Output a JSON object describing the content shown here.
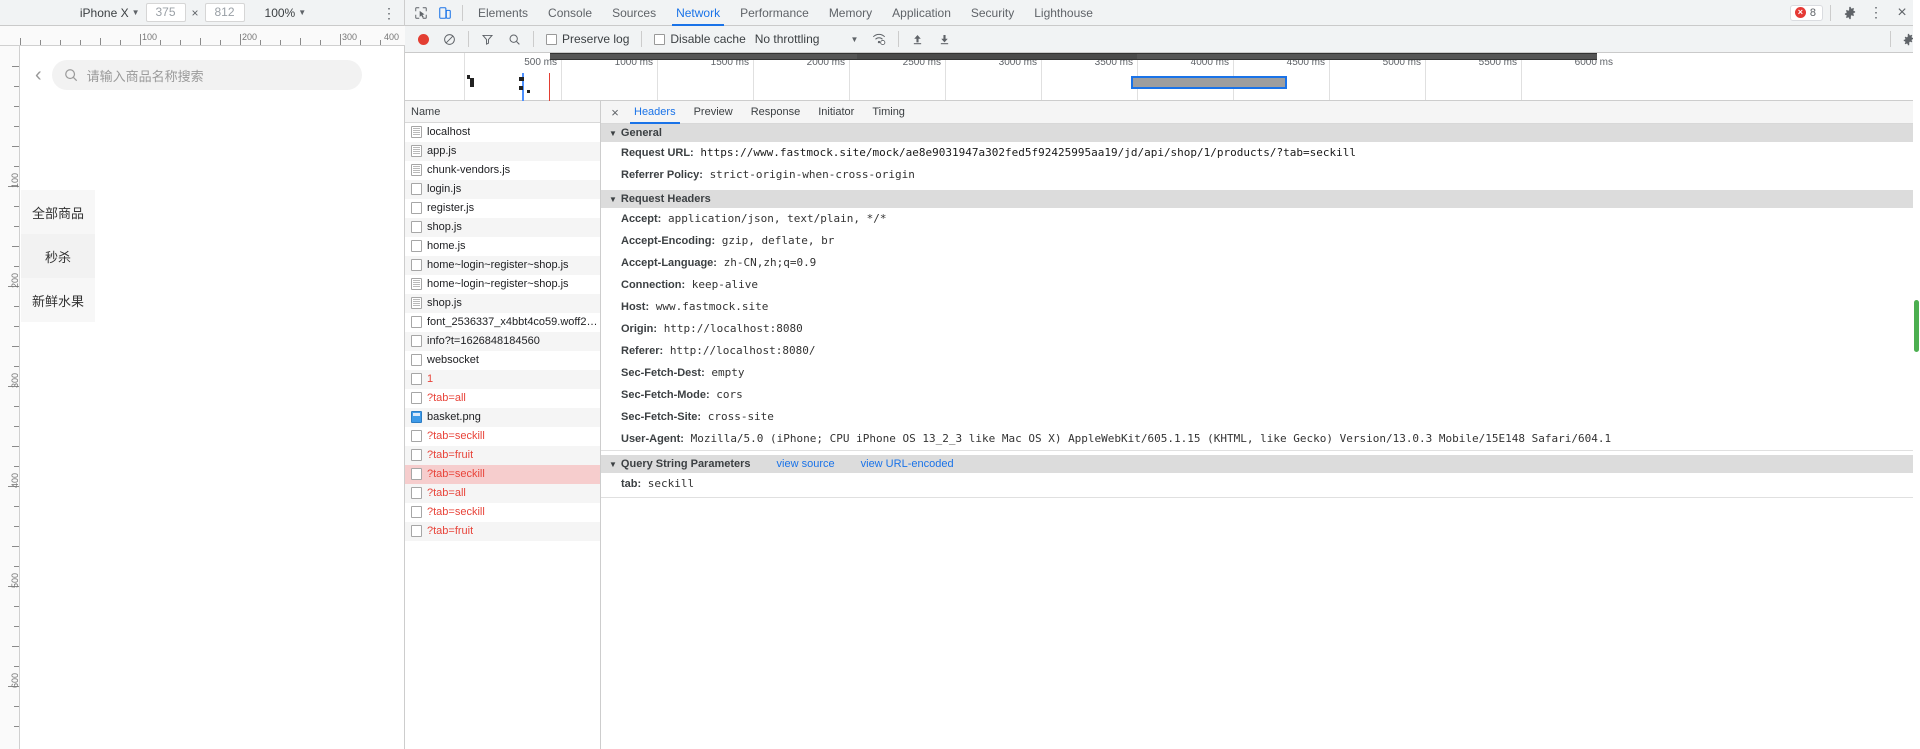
{
  "device_toolbar": {
    "device": "iPhone X",
    "width": "375",
    "height": "812",
    "zoom": "100%",
    "more_label": "⋮"
  },
  "mobile": {
    "back_icon": "‹",
    "search_placeholder": "请输入商品名称搜索",
    "categories": [
      {
        "label": "全部商品",
        "selected": false
      },
      {
        "label": "秒杀",
        "selected": true
      },
      {
        "label": "新鲜水果",
        "selected": false
      }
    ]
  },
  "ruler": {
    "h_labels": [
      "100",
      "200",
      "300",
      "400"
    ],
    "v_labels": [
      "100",
      "200",
      "300",
      "400",
      "500",
      "600"
    ]
  },
  "devtools": {
    "tabs": [
      {
        "label": "Elements",
        "active": false
      },
      {
        "label": "Console",
        "active": false
      },
      {
        "label": "Sources",
        "active": false
      },
      {
        "label": "Network",
        "active": true
      },
      {
        "label": "Performance",
        "active": false
      },
      {
        "label": "Memory",
        "active": false
      },
      {
        "label": "Application",
        "active": false
      },
      {
        "label": "Security",
        "active": false
      },
      {
        "label": "Lighthouse",
        "active": false
      }
    ],
    "error_count": "8",
    "error_glyph": "×",
    "settings_icon": "gear-icon",
    "more_icon": "⋮",
    "close_icon": "×"
  },
  "network_toolbar": {
    "record_label": "record-button",
    "clear_label": "clear-button",
    "filter_label": "filter-button",
    "search_label": "search-button",
    "preserve_log": "Preserve log",
    "disable_cache": "Disable cache",
    "throttling": "No throttling",
    "throttle_caret": "▼",
    "online_icon": "wifi-icon",
    "import_icon": "↑",
    "export_icon": "↓"
  },
  "overview": {
    "ticks": [
      "500 ms",
      "1000 ms",
      "1500 ms",
      "2000 ms",
      "2500 ms",
      "3000 ms",
      "3500 ms",
      "4000 ms",
      "4500 ms",
      "5000 ms",
      "5500 ms",
      "6000 ms"
    ],
    "selection_start_ms": "3350",
    "selection_end_ms": "4150"
  },
  "requests": {
    "column_name": "Name",
    "rows": [
      {
        "name": "localhost",
        "icon": "doc",
        "error": false,
        "selected": false
      },
      {
        "name": "app.js",
        "icon": "doc",
        "error": false,
        "selected": false
      },
      {
        "name": "chunk-vendors.js",
        "icon": "doc",
        "error": false,
        "selected": false
      },
      {
        "name": "login.js",
        "icon": "file",
        "error": false,
        "selected": false
      },
      {
        "name": "register.js",
        "icon": "file",
        "error": false,
        "selected": false
      },
      {
        "name": "shop.js",
        "icon": "file",
        "error": false,
        "selected": false
      },
      {
        "name": "home.js",
        "icon": "file",
        "error": false,
        "selected": false
      },
      {
        "name": "home~login~register~shop.js",
        "icon": "file",
        "error": false,
        "selected": false
      },
      {
        "name": "home~login~register~shop.js",
        "icon": "doc",
        "error": false,
        "selected": false
      },
      {
        "name": "shop.js",
        "icon": "doc",
        "error": false,
        "selected": false
      },
      {
        "name": "font_2536337_x4bbt4co59.woff2?…",
        "icon": "file",
        "error": false,
        "selected": false
      },
      {
        "name": "info?t=1626848184560",
        "icon": "file",
        "error": false,
        "selected": false
      },
      {
        "name": "websocket",
        "icon": "file",
        "error": false,
        "selected": false
      },
      {
        "name": "1",
        "icon": "file",
        "error": true,
        "selected": false
      },
      {
        "name": "?tab=all",
        "icon": "file",
        "error": true,
        "selected": false
      },
      {
        "name": "basket.png",
        "icon": "img",
        "error": false,
        "selected": false
      },
      {
        "name": "?tab=seckill",
        "icon": "file",
        "error": true,
        "selected": false
      },
      {
        "name": "?tab=fruit",
        "icon": "file",
        "error": true,
        "selected": false
      },
      {
        "name": "?tab=seckill",
        "icon": "file",
        "error": true,
        "selected": true
      },
      {
        "name": "?tab=all",
        "icon": "file",
        "error": true,
        "selected": false
      },
      {
        "name": "?tab=seckill",
        "icon": "file",
        "error": true,
        "selected": false
      },
      {
        "name": "?tab=fruit",
        "icon": "file",
        "error": true,
        "selected": false
      }
    ]
  },
  "detail": {
    "close_icon": "×",
    "tabs": [
      {
        "label": "Headers",
        "active": true
      },
      {
        "label": "Preview",
        "active": false
      },
      {
        "label": "Response",
        "active": false
      },
      {
        "label": "Initiator",
        "active": false
      },
      {
        "label": "Timing",
        "active": false
      }
    ],
    "general": {
      "title": "General",
      "items": [
        {
          "key": "Request URL:",
          "value": "https://www.fastmock.site/mock/ae8e9031947a302fed5f92425995aa19/jd/api/shop/1/products/?tab=seckill"
        },
        {
          "key": "Referrer Policy:",
          "value": "strict-origin-when-cross-origin"
        }
      ]
    },
    "request_headers": {
      "title": "Request Headers",
      "items": [
        {
          "key": "Accept:",
          "value": "application/json, text/plain, */*"
        },
        {
          "key": "Accept-Encoding:",
          "value": "gzip, deflate, br"
        },
        {
          "key": "Accept-Language:",
          "value": "zh-CN,zh;q=0.9"
        },
        {
          "key": "Connection:",
          "value": "keep-alive"
        },
        {
          "key": "Host:",
          "value": "www.fastmock.site"
        },
        {
          "key": "Origin:",
          "value": "http://localhost:8080"
        },
        {
          "key": "Referer:",
          "value": "http://localhost:8080/"
        },
        {
          "key": "Sec-Fetch-Dest:",
          "value": "empty"
        },
        {
          "key": "Sec-Fetch-Mode:",
          "value": "cors"
        },
        {
          "key": "Sec-Fetch-Site:",
          "value": "cross-site"
        },
        {
          "key": "User-Agent:",
          "value": "Mozilla/5.0 (iPhone; CPU iPhone OS 13_2_3 like Mac OS X) AppleWebKit/605.1.15 (KHTML, like Gecko) Version/13.0.3 Mobile/15E148 Safari/604.1"
        }
      ]
    },
    "query_string": {
      "title": "Query String Parameters",
      "view_source": "view source",
      "view_url_encoded": "view URL-encoded",
      "items": [
        {
          "key": "tab:",
          "value": "seckill"
        }
      ]
    }
  }
}
